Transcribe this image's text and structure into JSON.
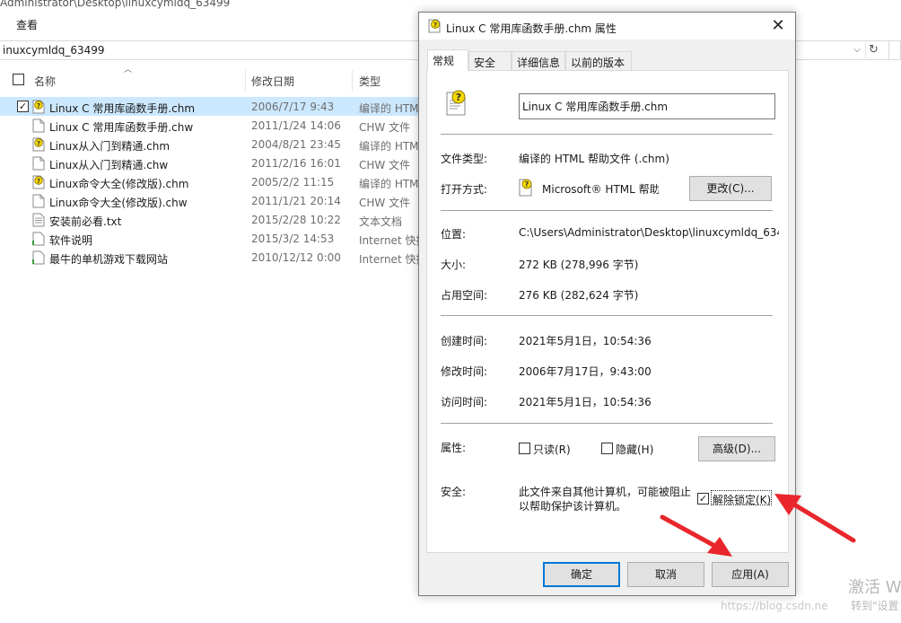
{
  "explorer": {
    "path_fragment": "Administrator\\Desktop\\linuxcymldq_63499",
    "menu_view": "查看",
    "address": "inuxcymldq_63499",
    "columns": {
      "name": "名称",
      "date": "修改日期",
      "type": "类型"
    },
    "files": [
      {
        "name": "Linux C 常用库函数手册.chm",
        "date": "2006/7/17 9:43",
        "type": "编译的 HTM",
        "icon": "chm-help-icon",
        "selected": true
      },
      {
        "name": "Linux C 常用库函数手册.chw",
        "date": "2011/1/24 14:06",
        "type": "CHW 文件",
        "icon": "file-icon",
        "selected": false
      },
      {
        "name": "Linux从入门到精通.chm",
        "date": "2004/8/21 23:45",
        "type": "编译的 HTM",
        "icon": "chm-help-icon",
        "selected": false
      },
      {
        "name": "Linux从入门到精通.chw",
        "date": "2011/2/16 16:01",
        "type": "CHW 文件",
        "icon": "file-icon",
        "selected": false
      },
      {
        "name": "Linux命令大全(修改版).chm",
        "date": "2005/2/2 11:15",
        "type": "编译的 HTM",
        "icon": "chm-help-icon",
        "selected": false
      },
      {
        "name": "Linux命令大全(修改版).chw",
        "date": "2011/1/21 20:14",
        "type": "CHW 文件",
        "icon": "file-icon",
        "selected": false
      },
      {
        "name": "安装前必看.txt",
        "date": "2015/2/28 10:22",
        "type": "文本文档",
        "icon": "text-file-icon",
        "selected": false
      },
      {
        "name": "软件说明",
        "date": "2015/3/2 14:53",
        "type": "Internet 快捷",
        "icon": "internet-shortcut-icon",
        "selected": false
      },
      {
        "name": "最牛的单机游戏下载网站",
        "date": "2010/12/12 0:00",
        "type": "Internet 快捷",
        "icon": "internet-shortcut-icon",
        "selected": false
      }
    ]
  },
  "dialog": {
    "title": "Linux C 常用库函数手册.chm 属性",
    "tabs": [
      "常规",
      "安全",
      "详细信息",
      "以前的版本"
    ],
    "filename": "Linux C 常用库函数手册.chm",
    "labels": {
      "file_type": "文件类型:",
      "opens_with": "打开方式:",
      "location": "位置:",
      "size": "大小:",
      "size_on_disk": "占用空间:",
      "created": "创建时间:",
      "modified": "修改时间:",
      "accessed": "访问时间:",
      "attributes": "属性:",
      "security": "安全:"
    },
    "values": {
      "file_type": "编译的 HTML 帮助文件 (.chm)",
      "opens_with": "Microsoft® HTML 帮助",
      "location": "C:\\Users\\Administrator\\Desktop\\linuxcymldq_634",
      "size": "272 KB (278,996 字节)",
      "size_on_disk": "276 KB (282,624 字节)",
      "created": "2021年5月1日，10:54:36",
      "modified": "2006年7月17日，9:43:00",
      "accessed": "2021年5月1日，10:54:36"
    },
    "change_button": "更改(C)...",
    "readonly_label": "只读(R)",
    "hidden_label": "隐藏(H)",
    "advanced_button": "高级(D)...",
    "security_text_line1": "此文件来自其他计算机，可能被阻止",
    "security_text_line2": "以帮助保护该计算机。",
    "unblock_label": "解除锁定(K)",
    "unblock_checked": true,
    "ok_button": "确定",
    "cancel_button": "取消",
    "apply_button": "应用(A)"
  },
  "watermark": {
    "activate": "激活 W",
    "settings": "转到\"设置",
    "url": "https://blog.csdn.ne"
  },
  "colors": {
    "selection": "#cce8ff",
    "accent": "#0078d7",
    "arrow": "#e8262b"
  }
}
